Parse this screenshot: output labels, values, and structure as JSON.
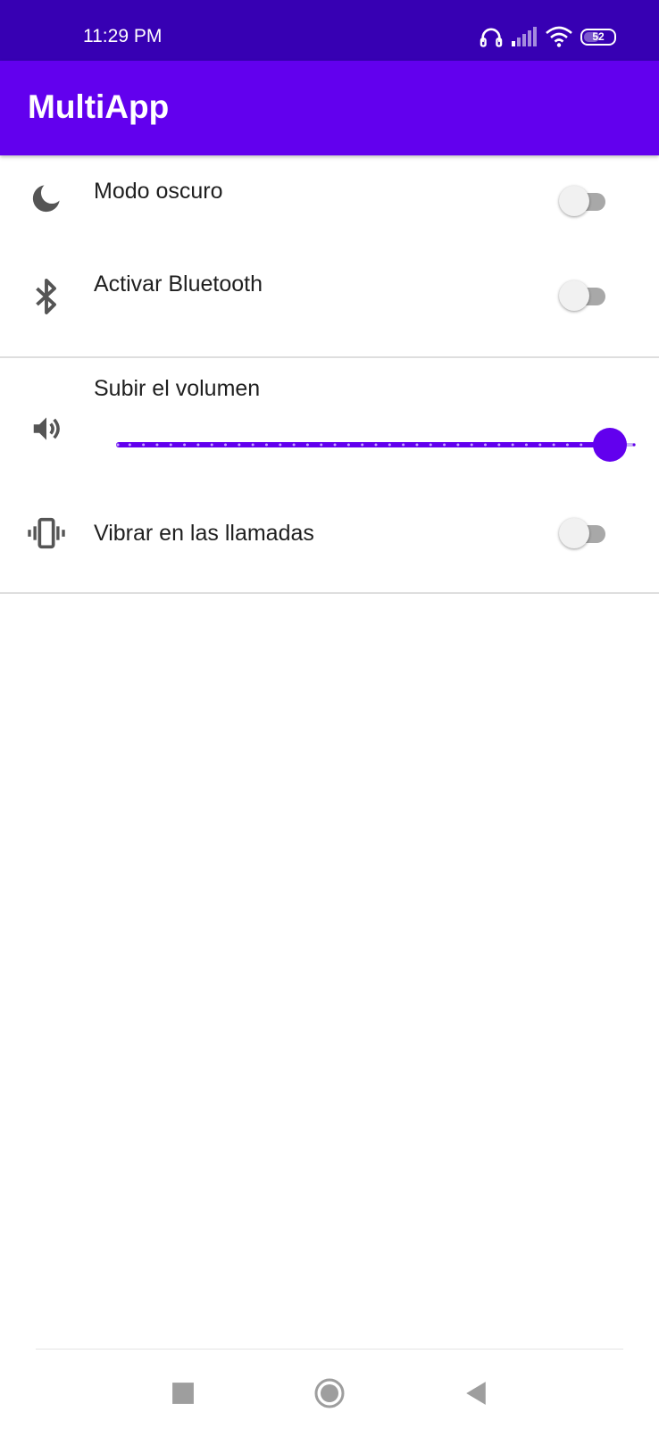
{
  "status_bar": {
    "time": "11:29 PM",
    "icons": [
      "headset-icon",
      "signal-icon",
      "wifi-icon",
      "battery-icon"
    ],
    "battery_level": "52",
    "background": "#3700b3"
  },
  "app_bar": {
    "title": "MultiApp",
    "color": "#6200ee"
  },
  "settings": {
    "dark_mode": {
      "label": "Modo oscuro",
      "icon": "moon-icon",
      "enabled": false
    },
    "bluetooth": {
      "label": "Activar Bluetooth",
      "icon": "bluetooth-icon",
      "enabled": false
    },
    "volume": {
      "label": "Subir el volumen",
      "icon": "speaker-icon",
      "level": 0.95,
      "steps": 38
    },
    "vibrate": {
      "label": "Vibrar en las llamadas",
      "icon": "vibrate-icon",
      "enabled": false
    }
  },
  "navigation": {
    "buttons": [
      "recents-button",
      "home-button",
      "back-button"
    ]
  }
}
